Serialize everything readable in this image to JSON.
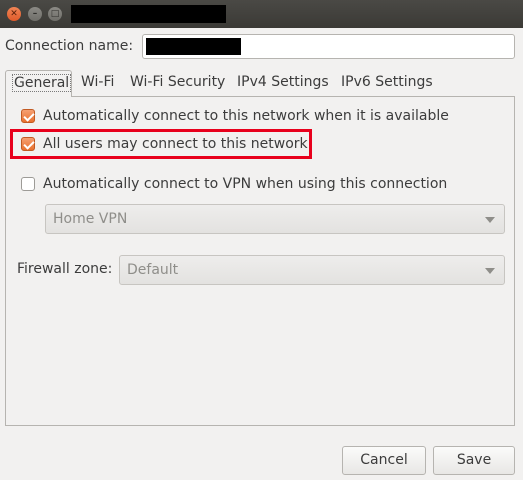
{
  "window": {
    "title": ""
  },
  "connection": {
    "label": "Connection name:",
    "value": ""
  },
  "tabs": [
    {
      "label": "General",
      "active": true
    },
    {
      "label": "Wi-Fi",
      "active": false
    },
    {
      "label": "Wi-Fi Security",
      "active": false
    },
    {
      "label": "IPv4 Settings",
      "active": false
    },
    {
      "label": "IPv6 Settings",
      "active": false
    }
  ],
  "general": {
    "auto_connect": {
      "label": "Automatically connect to this network when it is available",
      "checked": true
    },
    "all_users": {
      "label": "All users may connect to this network",
      "checked": true
    },
    "auto_vpn": {
      "label": "Automatically connect to VPN when using this connection",
      "checked": false
    },
    "vpn_select": {
      "value": "Home VPN"
    },
    "firewall": {
      "label": "Firewall zone:",
      "value": "Default"
    }
  },
  "buttons": {
    "cancel": "Cancel",
    "save": "Save"
  },
  "colors": {
    "accent": "#e8712f",
    "highlight": "#e8001c",
    "titlebar": "#3b3a36"
  }
}
